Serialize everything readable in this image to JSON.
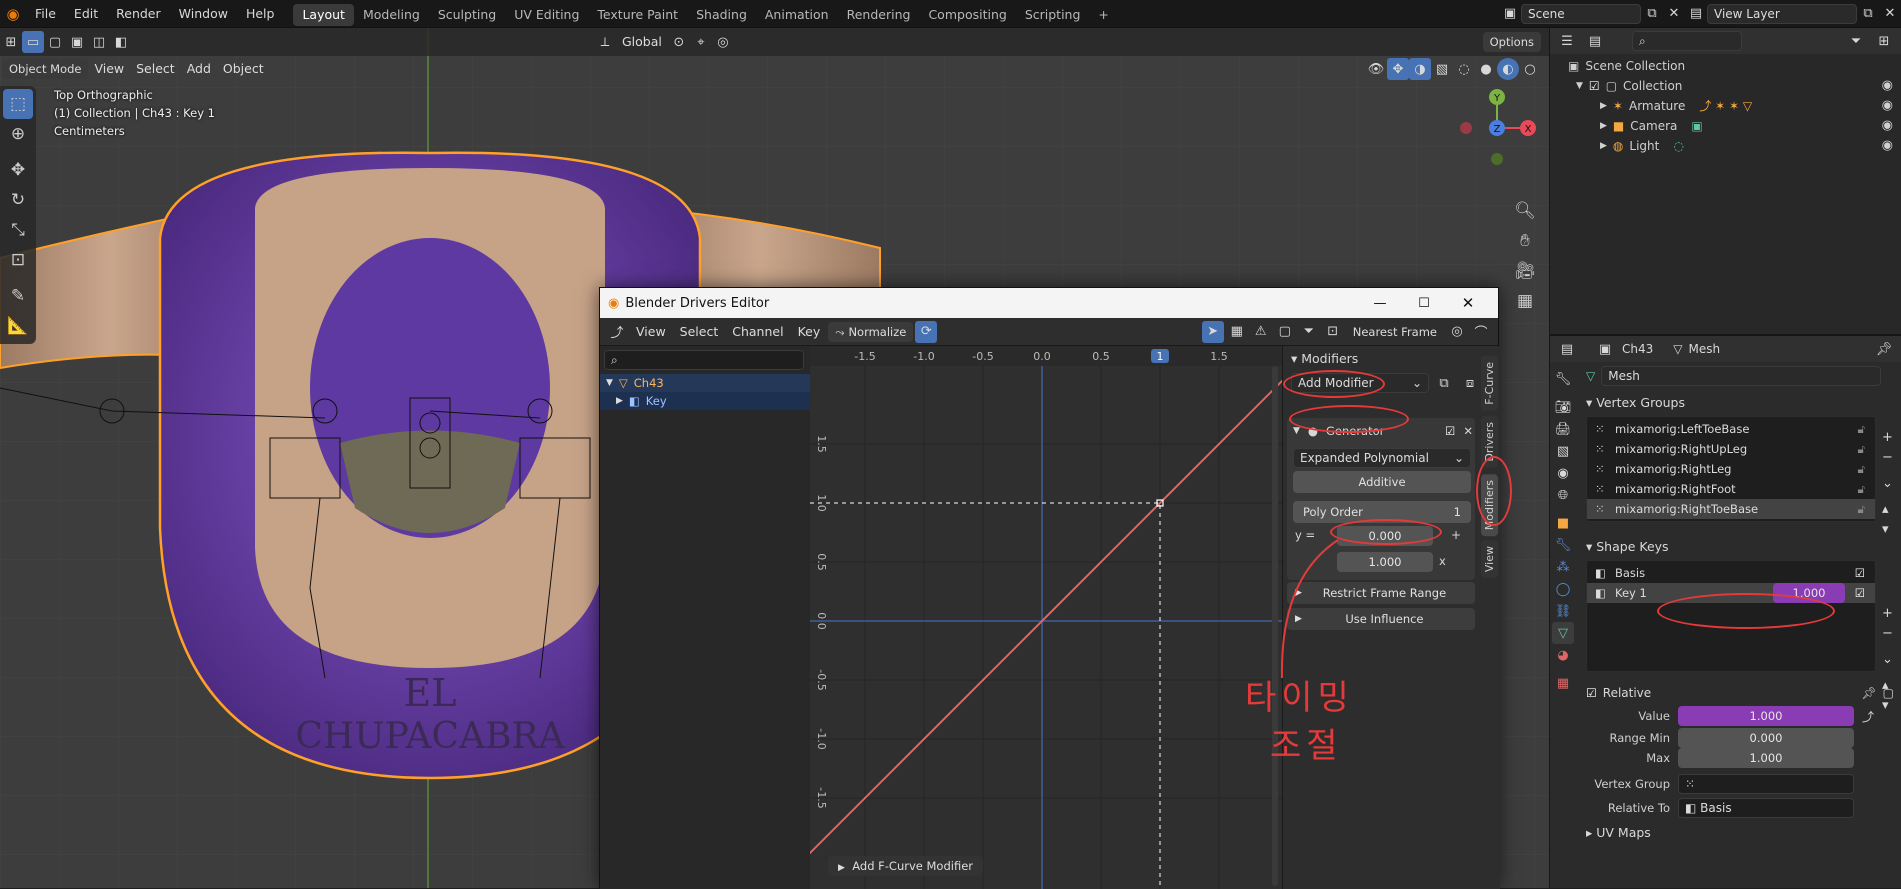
{
  "menubar": {
    "items": [
      "File",
      "Edit",
      "Render",
      "Window",
      "Help"
    ],
    "workspaces": [
      "Layout",
      "Modeling",
      "Sculpting",
      "UV Editing",
      "Texture Paint",
      "Shading",
      "Animation",
      "Rendering",
      "Compositing",
      "Scripting"
    ],
    "active_workspace": "Layout",
    "add_tab": "+",
    "scene": "Scene",
    "view_layer": "View Layer"
  },
  "viewport": {
    "mode": "Object Mode",
    "menus": [
      "View",
      "Select",
      "Add",
      "Object"
    ],
    "orientation": "Global",
    "options": "Options",
    "info_line1": "Top Orthographic",
    "info_line2": "(1) Collection | Ch43 : Key 1",
    "info_line3": "Centimeters",
    "gizmo_y": "Y",
    "gizmo_z": "Z",
    "gizmo_x": "X",
    "model_text_1": "EL",
    "model_text_2": "CHUPACABRA"
  },
  "outliner": {
    "root": "Scene Collection",
    "items": [
      {
        "label": "Collection",
        "indent": 1
      },
      {
        "label": "Armature",
        "indent": 2
      },
      {
        "label": "Camera",
        "indent": 2
      },
      {
        "label": "Light",
        "indent": 2
      }
    ]
  },
  "properties": {
    "object": "Ch43",
    "data": "Mesh",
    "mesh_name": "Mesh",
    "vertex_groups_title": "Vertex Groups",
    "vertex_groups": [
      "mixamorig:LeftToeBase",
      "mixamorig:RightUpLeg",
      "mixamorig:RightLeg",
      "mixamorig:RightFoot",
      "mixamorig:RightToeBase"
    ],
    "shape_keys_title": "Shape Keys",
    "shape_keys": [
      {
        "name": "Basis",
        "value": ""
      },
      {
        "name": "Key 1",
        "value": "1.000"
      }
    ],
    "relative_label": "Relative",
    "value_label": "Value",
    "value": "1.000",
    "range_min_label": "Range Min",
    "range_min": "0.000",
    "max_label": "Max",
    "max": "1.000",
    "vertex_group_label": "Vertex Group",
    "relative_to_label": "Relative To",
    "relative_to": "Basis",
    "uv_maps_title": "UV Maps"
  },
  "drivers_editor": {
    "title": "Blender Drivers Editor",
    "menus": [
      "View",
      "Select",
      "Channel",
      "Key"
    ],
    "normalize": "Normalize",
    "interp": "Nearest Frame",
    "channels": [
      {
        "label": "Ch43"
      },
      {
        "label": "Key"
      }
    ],
    "x_ticks": [
      "-1.5",
      "-1.0",
      "-0.5",
      "0.0",
      "0.5",
      "1",
      "1.5"
    ],
    "y_ticks": [
      "1.5",
      "1.0",
      "0.5",
      "0.0",
      "-0.5",
      "-1.0",
      "-1.5"
    ],
    "add_fcurve_modifier": "Add F-Curve Modifier",
    "modifiers_title": "Modifiers",
    "add_modifier": "Add Modifier",
    "generator": "Generator",
    "mode": "Expanded Polynomial",
    "additive": "Additive",
    "poly_order_label": "Poly Order",
    "poly_order": "1",
    "y_eq": "y =",
    "coef0": "0.000",
    "plus": "+",
    "coef1": "1.000",
    "x_suffix": "x",
    "restrict_frame_range": "Restrict Frame Range",
    "use_influence": "Use Influence",
    "tabs": [
      "F-Curve",
      "Drivers",
      "Modifiers",
      "View"
    ]
  },
  "annotation": {
    "line1": "타이밍",
    "line2": "조절"
  },
  "colors": {
    "accent": "#4772b3",
    "curve": "#e8625f",
    "annotation": "#e43a3a",
    "purple": "#8a3cb4",
    "highlight": "#ffa028"
  }
}
